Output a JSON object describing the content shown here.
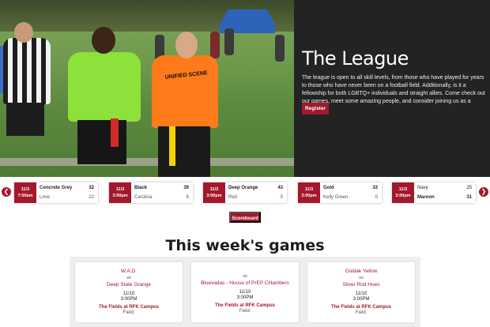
{
  "hero": {
    "title": "The League",
    "description": "The league is open to all skill levels, from those who have played for years to those who have never been on a football field. Additionally, is it a fellowship for both LGBTQ+ individuals and straight allies. Come check out our games, meet some amazing people, and consider joining us as a player!",
    "register_label": "Register",
    "jersey_text": "UNIFIED SCENE"
  },
  "scores": {
    "prev_icon": "chevron-left-icon",
    "next_icon": "chevron-right-icon",
    "cards": [
      {
        "date": "11/3",
        "time": "7:00am",
        "team1": "Concrete Grey",
        "score1": "32",
        "team2": "Lime",
        "score2": "22",
        "winner": 1
      },
      {
        "date": "11/3",
        "time": "3:00pm",
        "team1": "Black",
        "score1": "39",
        "team2": "Carolina",
        "score2": "6",
        "winner": 1
      },
      {
        "date": "11/3",
        "time": "3:00pm",
        "team1": "Deep Orange",
        "score1": "43",
        "team2": "Red",
        "score2": "0",
        "winner": 1
      },
      {
        "date": "11/3",
        "time": "3:00pm",
        "team1": "Gold",
        "score1": "33",
        "team2": "Kelly Green",
        "score2": "0",
        "winner": 1
      },
      {
        "date": "11/3",
        "time": "3:00pm",
        "team1": "Navy",
        "score1": "25",
        "team2": "Maroon",
        "score2": "31",
        "winner": 2
      }
    ]
  },
  "scoreboard_label": "Scoreboard",
  "week": {
    "title": "This week's games",
    "games": [
      {
        "home": "W.A.D.",
        "vs": "vs",
        "away": "Deep State Orange",
        "date": "11/10",
        "time": "3:00PM",
        "venue": "The Fields at RFK Campus",
        "field": "Field:"
      },
      {
        "home": "vs",
        "vs": "",
        "away": "Bluevadas - House of PrEP CHambers",
        "date": "11/10",
        "time": "3:00PM",
        "venue": "The Fields at RFK Campus",
        "field": "Field:"
      },
      {
        "home": "Goldak Yellow",
        "vs": "vs",
        "away": "Silver Rod Hoes",
        "date": "11/10",
        "time": "3:00PM",
        "venue": "The Fields at RFK Campus",
        "field": "Field:"
      }
    ]
  },
  "colors": {
    "accent": "#a3182c",
    "panel": "#232323"
  }
}
